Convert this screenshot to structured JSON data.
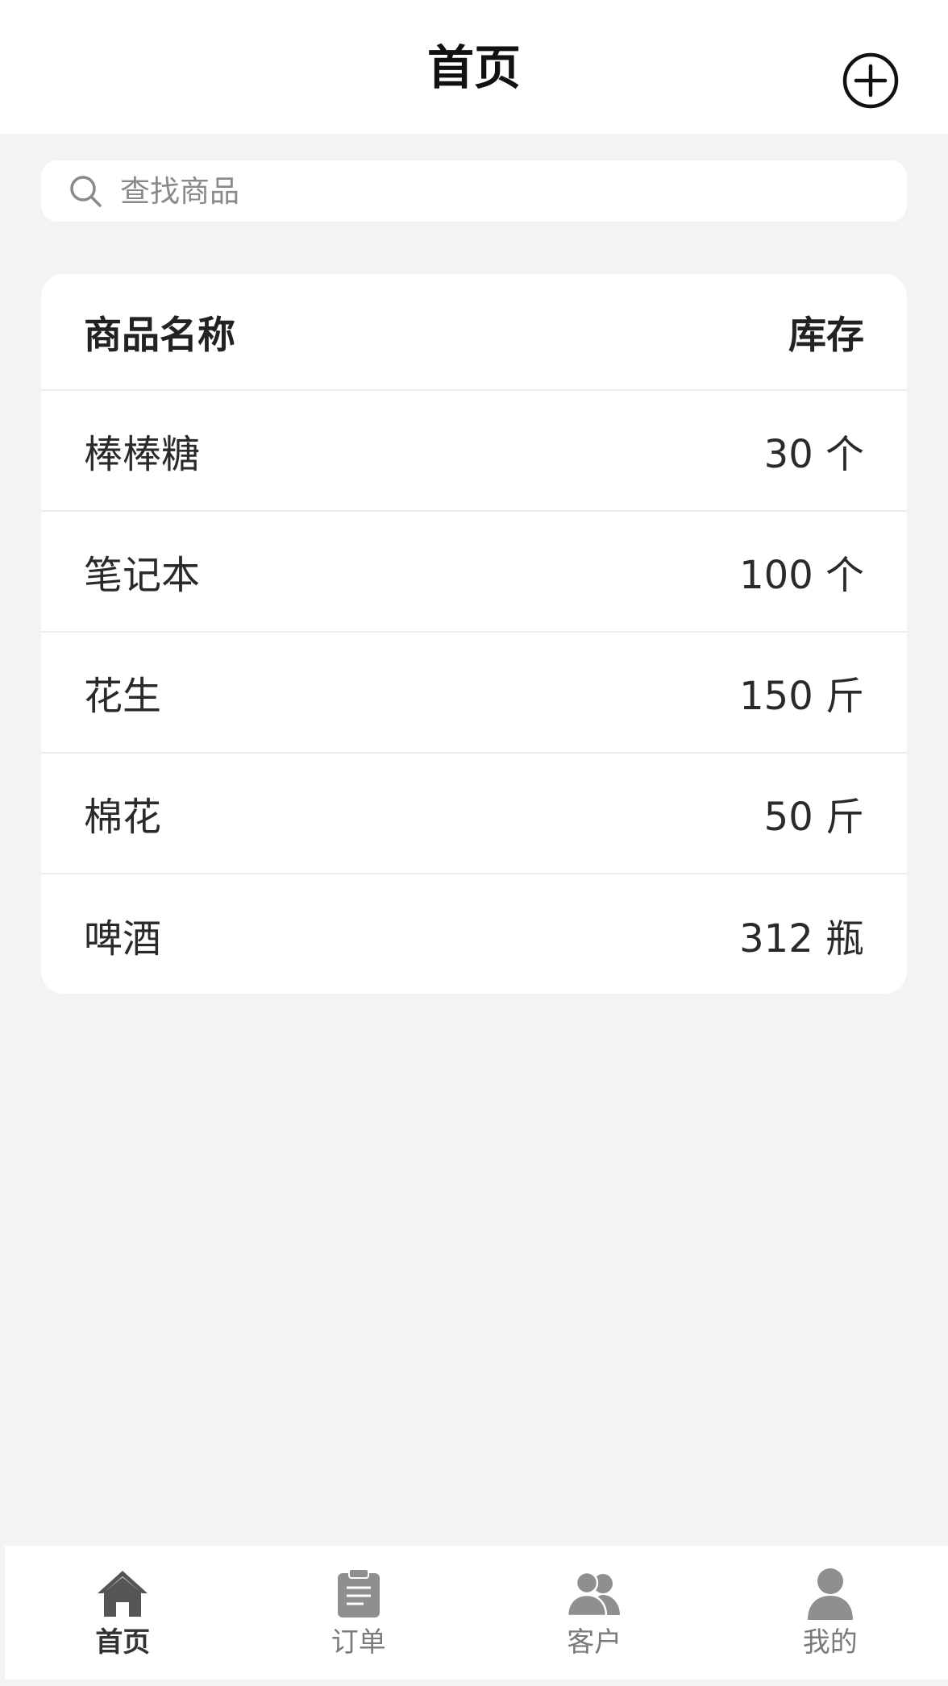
{
  "header": {
    "title": "首页"
  },
  "search": {
    "placeholder": "查找商品"
  },
  "table": {
    "headers": {
      "name": "商品名称",
      "stock": "库存"
    },
    "rows": [
      {
        "name": "棒棒糖",
        "stock": "30 个"
      },
      {
        "name": "笔记本",
        "stock": "100 个"
      },
      {
        "name": "花生",
        "stock": "150 斤"
      },
      {
        "name": "棉花",
        "stock": "50 斤"
      },
      {
        "name": "啤酒",
        "stock": "312 瓶"
      }
    ]
  },
  "tabbar": {
    "items": [
      {
        "label": "首页",
        "icon": "home-icon",
        "active": true
      },
      {
        "label": "订单",
        "icon": "clipboard-icon",
        "active": false
      },
      {
        "label": "客户",
        "icon": "users-icon",
        "active": false
      },
      {
        "label": "我的",
        "icon": "user-icon",
        "active": false
      }
    ]
  },
  "colors": {
    "background": "#f2f3f5",
    "surface": "#ffffff",
    "text_primary": "#222222",
    "tab_active": "#555555",
    "tab_inactive": "#8f8f8f"
  }
}
